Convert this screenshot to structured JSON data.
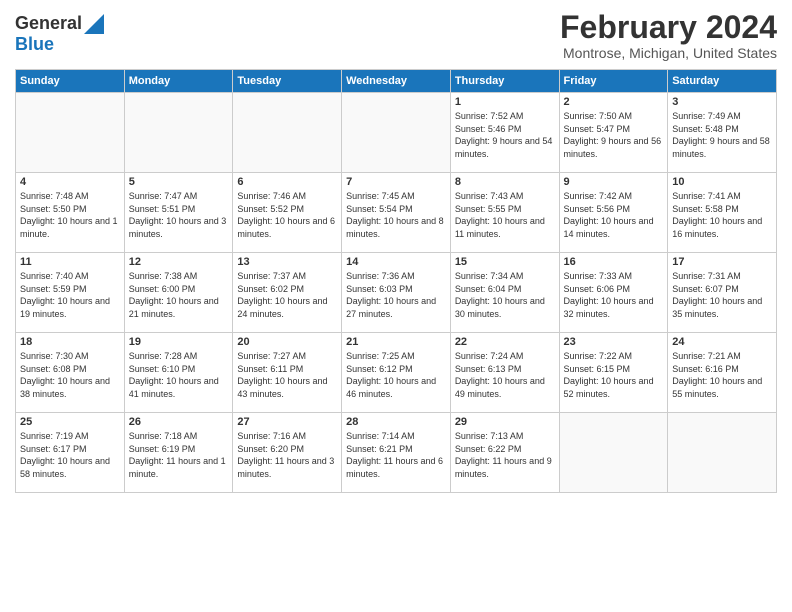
{
  "logo": {
    "line1": "General",
    "line2": "Blue"
  },
  "title": "February 2024",
  "subtitle": "Montrose, Michigan, United States",
  "days_of_week": [
    "Sunday",
    "Monday",
    "Tuesday",
    "Wednesday",
    "Thursday",
    "Friday",
    "Saturday"
  ],
  "weeks": [
    [
      {
        "day": "",
        "info": ""
      },
      {
        "day": "",
        "info": ""
      },
      {
        "day": "",
        "info": ""
      },
      {
        "day": "",
        "info": ""
      },
      {
        "day": "1",
        "info": "Sunrise: 7:52 AM\nSunset: 5:46 PM\nDaylight: 9 hours and 54 minutes."
      },
      {
        "day": "2",
        "info": "Sunrise: 7:50 AM\nSunset: 5:47 PM\nDaylight: 9 hours and 56 minutes."
      },
      {
        "day": "3",
        "info": "Sunrise: 7:49 AM\nSunset: 5:48 PM\nDaylight: 9 hours and 58 minutes."
      }
    ],
    [
      {
        "day": "4",
        "info": "Sunrise: 7:48 AM\nSunset: 5:50 PM\nDaylight: 10 hours and 1 minute."
      },
      {
        "day": "5",
        "info": "Sunrise: 7:47 AM\nSunset: 5:51 PM\nDaylight: 10 hours and 3 minutes."
      },
      {
        "day": "6",
        "info": "Sunrise: 7:46 AM\nSunset: 5:52 PM\nDaylight: 10 hours and 6 minutes."
      },
      {
        "day": "7",
        "info": "Sunrise: 7:45 AM\nSunset: 5:54 PM\nDaylight: 10 hours and 8 minutes."
      },
      {
        "day": "8",
        "info": "Sunrise: 7:43 AM\nSunset: 5:55 PM\nDaylight: 10 hours and 11 minutes."
      },
      {
        "day": "9",
        "info": "Sunrise: 7:42 AM\nSunset: 5:56 PM\nDaylight: 10 hours and 14 minutes."
      },
      {
        "day": "10",
        "info": "Sunrise: 7:41 AM\nSunset: 5:58 PM\nDaylight: 10 hours and 16 minutes."
      }
    ],
    [
      {
        "day": "11",
        "info": "Sunrise: 7:40 AM\nSunset: 5:59 PM\nDaylight: 10 hours and 19 minutes."
      },
      {
        "day": "12",
        "info": "Sunrise: 7:38 AM\nSunset: 6:00 PM\nDaylight: 10 hours and 21 minutes."
      },
      {
        "day": "13",
        "info": "Sunrise: 7:37 AM\nSunset: 6:02 PM\nDaylight: 10 hours and 24 minutes."
      },
      {
        "day": "14",
        "info": "Sunrise: 7:36 AM\nSunset: 6:03 PM\nDaylight: 10 hours and 27 minutes."
      },
      {
        "day": "15",
        "info": "Sunrise: 7:34 AM\nSunset: 6:04 PM\nDaylight: 10 hours and 30 minutes."
      },
      {
        "day": "16",
        "info": "Sunrise: 7:33 AM\nSunset: 6:06 PM\nDaylight: 10 hours and 32 minutes."
      },
      {
        "day": "17",
        "info": "Sunrise: 7:31 AM\nSunset: 6:07 PM\nDaylight: 10 hours and 35 minutes."
      }
    ],
    [
      {
        "day": "18",
        "info": "Sunrise: 7:30 AM\nSunset: 6:08 PM\nDaylight: 10 hours and 38 minutes."
      },
      {
        "day": "19",
        "info": "Sunrise: 7:28 AM\nSunset: 6:10 PM\nDaylight: 10 hours and 41 minutes."
      },
      {
        "day": "20",
        "info": "Sunrise: 7:27 AM\nSunset: 6:11 PM\nDaylight: 10 hours and 43 minutes."
      },
      {
        "day": "21",
        "info": "Sunrise: 7:25 AM\nSunset: 6:12 PM\nDaylight: 10 hours and 46 minutes."
      },
      {
        "day": "22",
        "info": "Sunrise: 7:24 AM\nSunset: 6:13 PM\nDaylight: 10 hours and 49 minutes."
      },
      {
        "day": "23",
        "info": "Sunrise: 7:22 AM\nSunset: 6:15 PM\nDaylight: 10 hours and 52 minutes."
      },
      {
        "day": "24",
        "info": "Sunrise: 7:21 AM\nSunset: 6:16 PM\nDaylight: 10 hours and 55 minutes."
      }
    ],
    [
      {
        "day": "25",
        "info": "Sunrise: 7:19 AM\nSunset: 6:17 PM\nDaylight: 10 hours and 58 minutes."
      },
      {
        "day": "26",
        "info": "Sunrise: 7:18 AM\nSunset: 6:19 PM\nDaylight: 11 hours and 1 minute."
      },
      {
        "day": "27",
        "info": "Sunrise: 7:16 AM\nSunset: 6:20 PM\nDaylight: 11 hours and 3 minutes."
      },
      {
        "day": "28",
        "info": "Sunrise: 7:14 AM\nSunset: 6:21 PM\nDaylight: 11 hours and 6 minutes."
      },
      {
        "day": "29",
        "info": "Sunrise: 7:13 AM\nSunset: 6:22 PM\nDaylight: 11 hours and 9 minutes."
      },
      {
        "day": "",
        "info": ""
      },
      {
        "day": "",
        "info": ""
      }
    ]
  ]
}
